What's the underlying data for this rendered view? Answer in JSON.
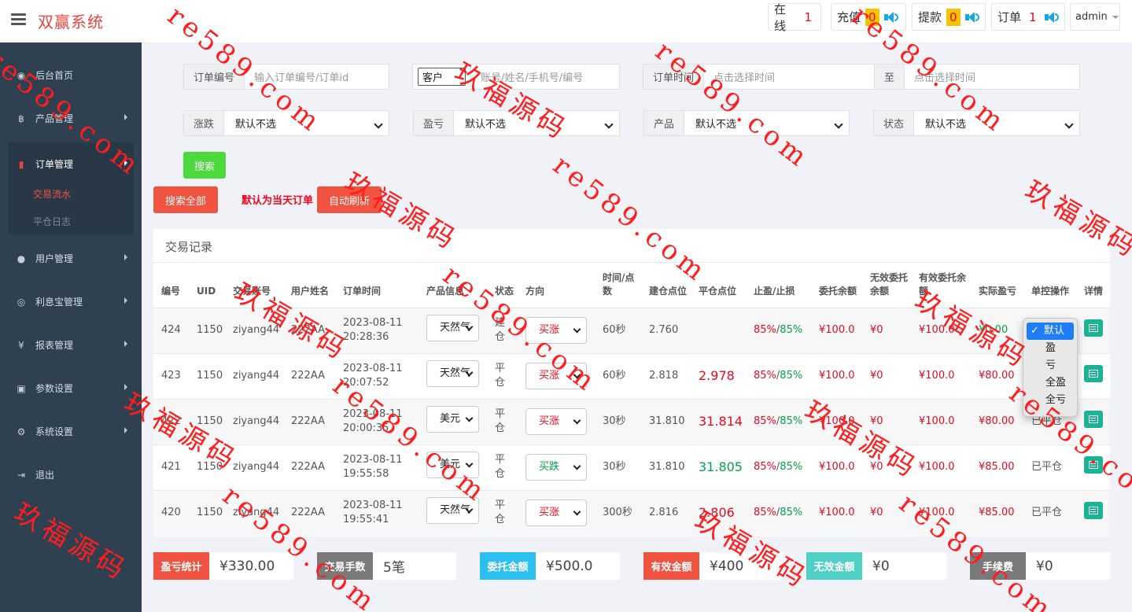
{
  "app": {
    "title": "双赢系统"
  },
  "topbar": {
    "online_label": "在线",
    "online_count": "1",
    "recharge_label": "充值",
    "recharge_count": "0",
    "withdraw_label": "提款",
    "withdraw_count": "0",
    "order_label": "订单",
    "order_count": "1",
    "user": "admin"
  },
  "sidebar": {
    "items": [
      {
        "icon": "dashboard-icon",
        "label": "后台首页"
      },
      {
        "icon": "bitcoin-icon",
        "label": "产品管理"
      },
      {
        "icon": "file-icon",
        "label": "订单管理"
      },
      {
        "icon": "user-icon",
        "label": "用户管理"
      },
      {
        "icon": "chip-icon",
        "label": "利息宝管理"
      },
      {
        "icon": "yen-icon",
        "label": "报表管理"
      },
      {
        "icon": "copy-icon",
        "label": "参数设置"
      },
      {
        "icon": "gears-icon",
        "label": "系统设置"
      },
      {
        "icon": "signout-icon",
        "label": "退出"
      }
    ],
    "sub": [
      "交易流水",
      "平仓日志"
    ]
  },
  "filters": {
    "order_no_label": "订单编号",
    "order_no_placeholder": "输入订单编号/订单id",
    "customer_select": "客户",
    "customer_placeholder": "账号/姓名/手机号/编号",
    "time_label": "订单时间",
    "time_placeholder": "点击选择时间",
    "to_label": "至",
    "time_placeholder2": "点击选择时间",
    "rise_fall_label": "涨跌",
    "rise_fall_value": "默认不选",
    "pnl_label": "盈亏",
    "pnl_value": "默认不选",
    "product_label": "产品",
    "product_value": "默认不选",
    "status_label": "状态",
    "status_value": "默认不选",
    "search_btn": "搜索",
    "search_all_btn": "搜索全部",
    "default_note": "默认为当天订单",
    "auto_refresh_btn": "自动刷新"
  },
  "panel": {
    "title": "交易记录"
  },
  "table": {
    "headers": [
      "编号",
      "UID",
      "交易账号",
      "用户姓名",
      "订单时间",
      "产品信息",
      "状态",
      "方向",
      "时间/点数",
      "建仓点位",
      "平仓点位",
      "止盈/止损",
      "委托余额",
      "无效委托余额",
      "有效委托余额",
      "实际盈亏",
      "单控操作",
      "详情"
    ],
    "rows": [
      {
        "id": "424",
        "uid": "1150",
        "account": "ziyang44",
        "name": "222AA",
        "date": "2023-08-11",
        "time": "20:28:36",
        "product": "天然气",
        "status": "建仓",
        "direction": "买涨",
        "period": "60秒",
        "open": "2.760",
        "close": "",
        "tp": "85%",
        "sl": "85%",
        "amount": "¥100.0",
        "invalid": "¥0",
        "valid": "¥100.0",
        "pnl": "¥0.00",
        "control": ""
      },
      {
        "id": "423",
        "uid": "1150",
        "account": "ziyang44",
        "name": "222AA",
        "date": "2023-08-11",
        "time": "20:07:52",
        "product": "天然气",
        "status": "平仓",
        "direction": "买涨",
        "period": "60秒",
        "open": "2.818",
        "close": "2.978",
        "tp": "85%",
        "sl": "85%",
        "amount": "¥100.0",
        "invalid": "¥0",
        "valid": "¥100.0",
        "pnl": "¥80.00",
        "control": ""
      },
      {
        "id": "422",
        "uid": "1150",
        "account": "ziyang44",
        "name": "222AA",
        "date": "2023-08-11",
        "time": "20:00:35",
        "product": "美元",
        "status": "平仓",
        "direction": "买涨",
        "period": "30秒",
        "open": "31.810",
        "close": "31.814",
        "tp": "85%",
        "sl": "85%",
        "amount": "¥100.0",
        "invalid": "¥0",
        "valid": "¥100.0",
        "pnl": "¥80.00",
        "control": "已平仓"
      },
      {
        "id": "421",
        "uid": "1150",
        "account": "ziyang44",
        "name": "222AA",
        "date": "2023-08-11",
        "time": "19:55:58",
        "product": "美元",
        "status": "平仓",
        "direction": "买跌",
        "period": "30秒",
        "open": "31.810",
        "close": "31.805",
        "tp": "85%",
        "sl": "85%",
        "amount": "¥100.0",
        "invalid": "¥0",
        "valid": "¥100.0",
        "pnl": "¥85.00",
        "control": "已平仓"
      },
      {
        "id": "420",
        "uid": "1150",
        "account": "ziyang44",
        "name": "222AA",
        "date": "2023-08-11",
        "time": "19:55:41",
        "product": "天然气",
        "status": "平仓",
        "direction": "买涨",
        "period": "300秒",
        "open": "2.816",
        "close": "2.806",
        "tp": "85%",
        "sl": "85%",
        "amount": "¥100.0",
        "invalid": "¥0",
        "valid": "¥100.0",
        "pnl": "¥85.00",
        "control": "已平仓"
      }
    ]
  },
  "dropdown": {
    "options": [
      "默认",
      "盈",
      "亏",
      "全盈",
      "全亏"
    ],
    "selected": "默认"
  },
  "stats": [
    {
      "label": "盈亏统计",
      "value": "¥330.00",
      "color": "#f0533f"
    },
    {
      "label": "交易手数",
      "value": "5笔",
      "color": "#7a7a7a"
    },
    {
      "label": "委托金额",
      "value": "¥500.0",
      "color": "#2cc0f0"
    },
    {
      "label": "有效金额",
      "value": "¥400",
      "color": "#f0533f"
    },
    {
      "label": "无效金额",
      "value": "¥0",
      "color": "#4fcfc6"
    },
    {
      "label": "手续费",
      "value": "¥0",
      "color": "#7a7a7a"
    }
  ],
  "watermark": {
    "text_a": "玖福源码",
    "text_b": "re589.com"
  },
  "colors": {
    "brand": "#e8453c",
    "sidebar": "#2f4050",
    "success": "#4cd93c",
    "danger": "#f0533f",
    "teal": "#1ab394"
  }
}
